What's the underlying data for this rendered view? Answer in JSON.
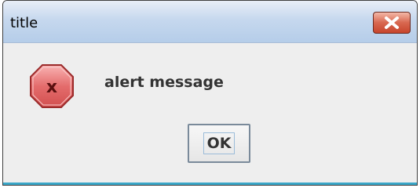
{
  "dialog": {
    "title": "title",
    "message": "alert message",
    "ok_label": "OK"
  },
  "icons": {
    "close": "close-icon",
    "error": "error-icon"
  },
  "colors": {
    "titlebar": "#c6d8ee",
    "close_button": "#d8674f",
    "error_icon": "#e46c6c",
    "content_bg": "#eeeeee"
  }
}
